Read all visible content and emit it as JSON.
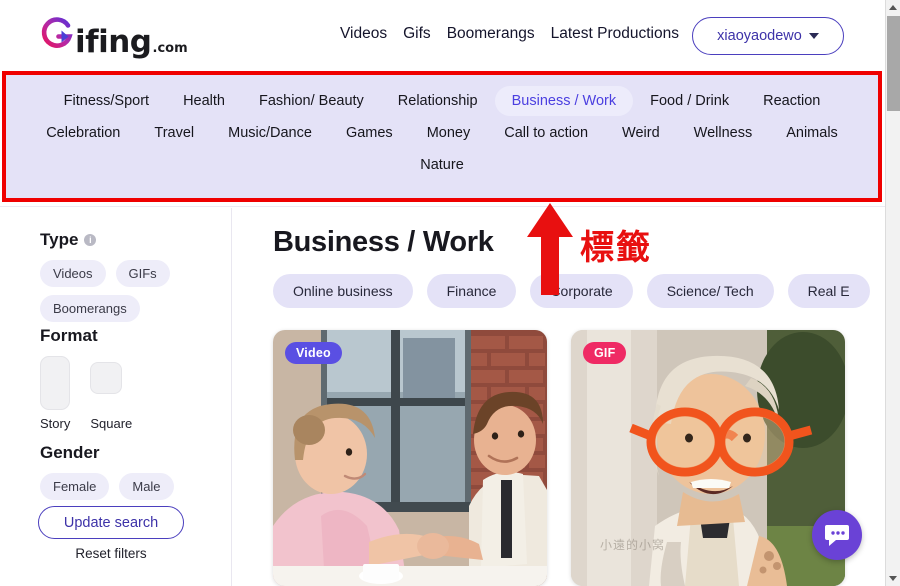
{
  "header": {
    "logo_text": "ifing",
    "logo_suffix": ".com",
    "nav_items": [
      {
        "label": "Videos"
      },
      {
        "label": "Gifs"
      },
      {
        "label": "Boomerangs"
      },
      {
        "label": "Latest Productions"
      }
    ],
    "user": {
      "name": "xiaoyaodewo",
      "caret_icon": "chevron-down-icon"
    }
  },
  "category_bar": {
    "active": "Business / Work",
    "rows": [
      [
        "Fitness/Sport",
        "Health",
        "Fashion/ Beauty",
        "Relationship",
        "Business / Work",
        "Food / Drink",
        "Reaction"
      ],
      [
        "Celebration",
        "Travel",
        "Music/Dance",
        "Games",
        "Money",
        "Call to action",
        "Weird",
        "Wellness",
        "Animals"
      ],
      [
        "Nature"
      ]
    ]
  },
  "sidebar": {
    "type": {
      "label": "Type",
      "info_icon": "info-icon",
      "options": [
        "Videos",
        "GIFs",
        "Boomerangs"
      ]
    },
    "format": {
      "label": "Format",
      "options": [
        {
          "label": "Story",
          "shape": "story-portrait-icon"
        },
        {
          "label": "Square",
          "shape": "square-icon"
        }
      ]
    },
    "gender": {
      "label": "Gender",
      "options": [
        "Female",
        "Male"
      ]
    },
    "update_button": "Update search",
    "reset_link": "Reset filters"
  },
  "main": {
    "title": "Business / Work",
    "subcategories": [
      "Online business",
      "Finance",
      "Corporate",
      "Science/ Tech",
      "Real E"
    ],
    "cards": [
      {
        "badge": "Video",
        "badge_type": "video",
        "alt": "two colleagues talking at a table in a brick-wall office"
      },
      {
        "badge": "GIF",
        "badge_type": "gif",
        "alt": "woman wearing oversized orange glasses outdoors"
      }
    ]
  },
  "floating_chat": {
    "icon": "chat-bubble-icon"
  },
  "annotation": {
    "text": "標籤",
    "arrow_icon": "up-arrow-annotation",
    "color": "#e81010",
    "box_color": "#ef0000"
  },
  "watermark": "小遠的小窝",
  "colors": {
    "accent_purple": "#4b3fe0",
    "brand_indigo": "#3d32a8",
    "cat_bar_bg": "#e4e2f7",
    "badge_video": "#5a4fe3",
    "badge_gif": "#ef2a64",
    "fab_purple": "#6a42d6"
  },
  "scrollbar": {
    "up_icon": "triangle-up-icon",
    "down_icon": "triangle-down-icon"
  }
}
